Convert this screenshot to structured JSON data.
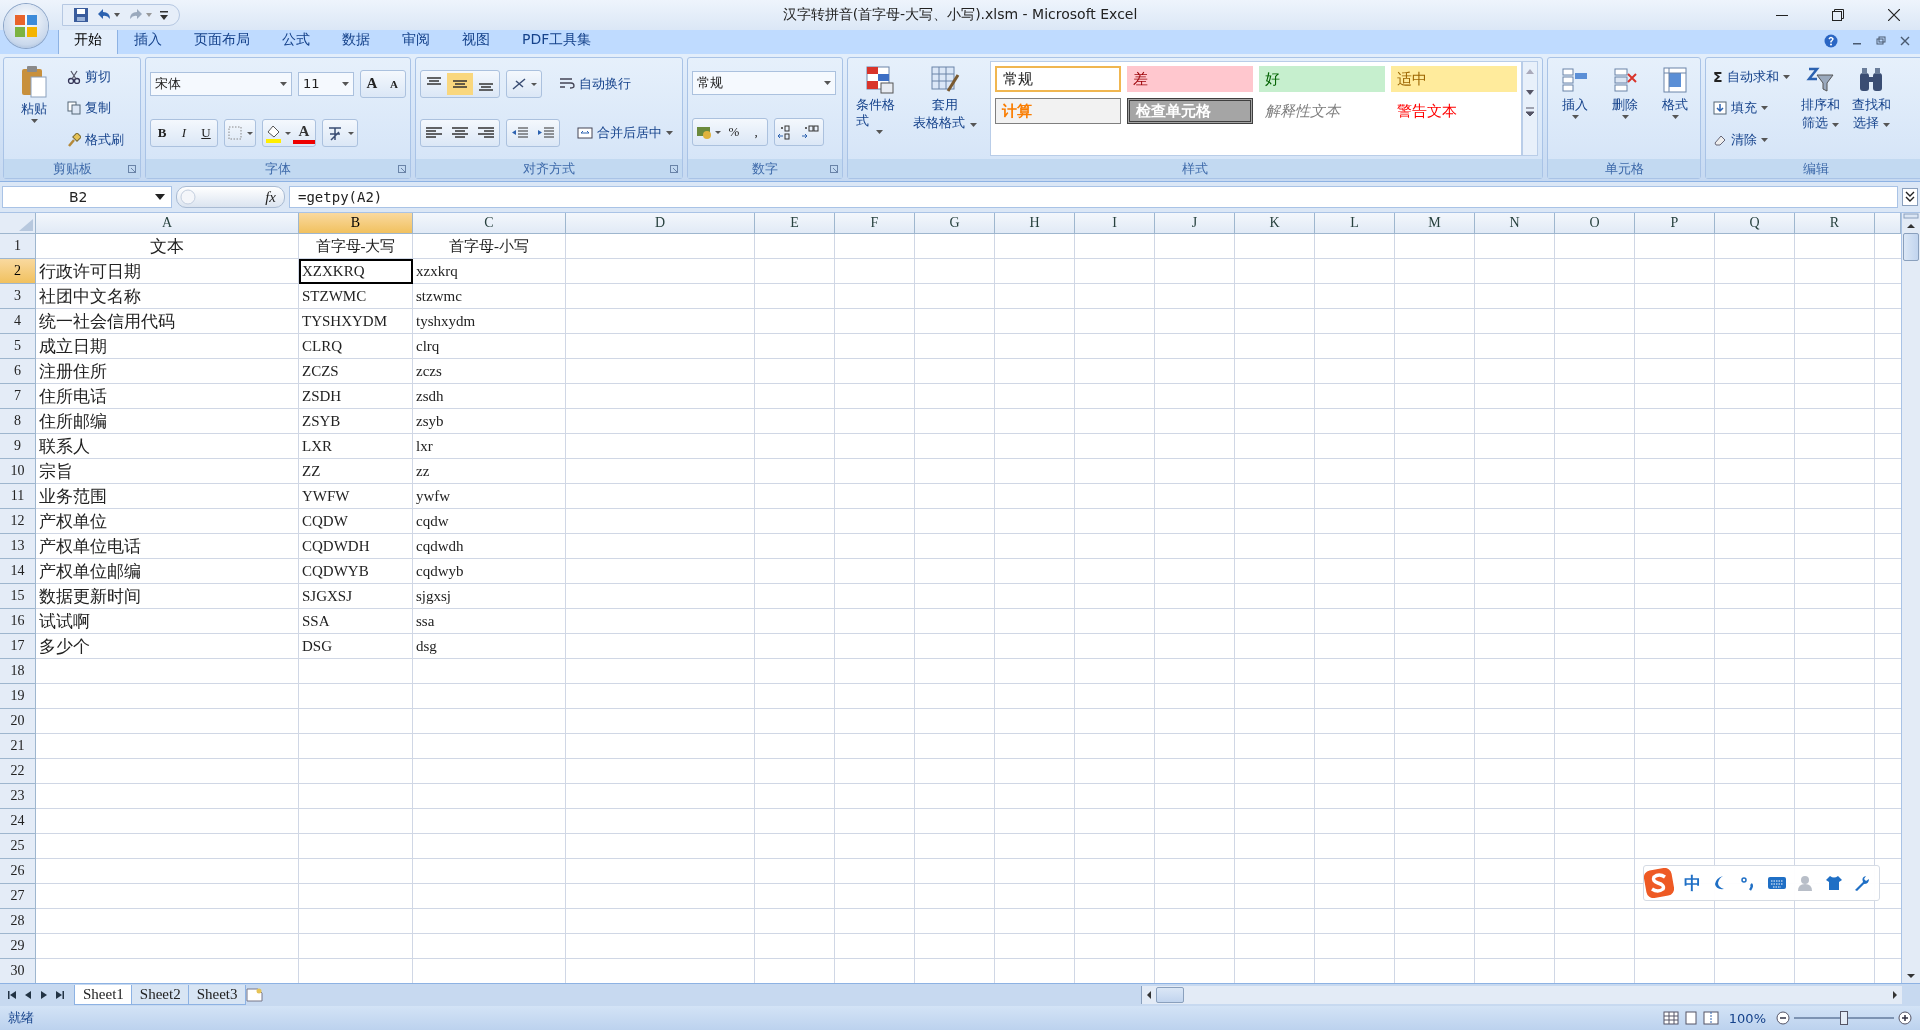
{
  "window": {
    "title": "汉字转拼音(首字母-大写、小写).xlsm - Microsoft Excel"
  },
  "menu_tabs": [
    {
      "label": "开始",
      "selected": true
    },
    {
      "label": "插入",
      "selected": false
    },
    {
      "label": "页面布局",
      "selected": false
    },
    {
      "label": "公式",
      "selected": false
    },
    {
      "label": "数据",
      "selected": false
    },
    {
      "label": "审阅",
      "selected": false
    },
    {
      "label": "视图",
      "selected": false
    },
    {
      "label": "PDF工具集",
      "selected": false
    }
  ],
  "ribbon": {
    "clipboard": {
      "label": "剪贴板",
      "paste": "粘贴",
      "commands": [
        "剪切",
        "复制",
        "格式刷"
      ]
    },
    "font": {
      "label": "字体",
      "font_name": "宋体",
      "font_size": "11",
      "grow": "A",
      "shrink": "A",
      "format_buttons": [
        "B",
        "I",
        "U"
      ],
      "color_letter": "A"
    },
    "alignment": {
      "label": "对齐方式",
      "wrap": "自动换行",
      "merge": "合并后居中"
    },
    "number": {
      "label": "数字",
      "format": "常规",
      "percent": "%",
      "comma": ","
    },
    "styles": {
      "label": "样式",
      "conditional": "条件格式",
      "table_format": [
        "套用",
        "表格格式"
      ],
      "cell_styles": [
        {
          "name": "常规",
          "kind": "normal"
        },
        {
          "name": "差",
          "kind": "bad"
        },
        {
          "name": "好",
          "kind": "good"
        },
        {
          "name": "适中",
          "kind": "neutral"
        },
        {
          "name": "计算",
          "kind": "calculation"
        },
        {
          "name": "检查单元格",
          "kind": "check"
        },
        {
          "name": "解释性文本",
          "kind": "explanatory"
        },
        {
          "name": "警告文本",
          "kind": "warning"
        }
      ]
    },
    "cells": {
      "label": "单元格",
      "commands": [
        "插入",
        "删除",
        "格式"
      ]
    },
    "editing": {
      "label": "编辑",
      "autosum_symbol": "Σ",
      "commands": [
        "自动求和",
        "填充",
        "清除"
      ],
      "large": [
        [
          "排序和",
          "筛选"
        ],
        [
          "查找和",
          "选择"
        ]
      ]
    }
  },
  "formula_bar": {
    "name_box": "B2",
    "fx": "fx",
    "formula": "=getpy(A2)"
  },
  "sheet": {
    "columns": [
      {
        "label": "A",
        "selected": false
      },
      {
        "label": "B",
        "selected": true
      },
      {
        "label": "C",
        "selected": false
      },
      {
        "label": "D",
        "selected": false
      },
      {
        "label": "E",
        "selected": false
      },
      {
        "label": "F",
        "selected": false
      },
      {
        "label": "G",
        "selected": false
      },
      {
        "label": "H",
        "selected": false
      },
      {
        "label": "I",
        "selected": false
      },
      {
        "label": "J",
        "selected": false
      },
      {
        "label": "K",
        "selected": false
      },
      {
        "label": "L",
        "selected": false
      },
      {
        "label": "M",
        "selected": false
      },
      {
        "label": "N",
        "selected": false
      },
      {
        "label": "O",
        "selected": false
      },
      {
        "label": "P",
        "selected": false
      },
      {
        "label": "Q",
        "selected": false
      },
      {
        "label": "R",
        "selected": false
      }
    ],
    "rows": [
      {
        "number": "1",
        "kind": "header",
        "selected": false,
        "cells": [
          "文本",
          "首字母-大写",
          "首字母-小写"
        ]
      },
      {
        "number": "2",
        "kind": "data",
        "selected": true,
        "cells": [
          "行政许可日期",
          "XZXKRQ",
          "xzxkrq"
        ]
      },
      {
        "number": "3",
        "kind": "data",
        "selected": false,
        "cells": [
          "社团中文名称",
          "STZWMC",
          "stzwmc"
        ]
      },
      {
        "number": "4",
        "kind": "data",
        "selected": false,
        "cells": [
          "统一社会信用代码",
          "TYSHXYDM",
          "tyshxydm"
        ]
      },
      {
        "number": "5",
        "kind": "data",
        "selected": false,
        "cells": [
          "成立日期",
          "CLRQ",
          "clrq"
        ]
      },
      {
        "number": "6",
        "kind": "data",
        "selected": false,
        "cells": [
          "注册住所",
          "ZCZS",
          "zczs"
        ]
      },
      {
        "number": "7",
        "kind": "data",
        "selected": false,
        "cells": [
          "住所电话",
          "ZSDH",
          "zsdh"
        ]
      },
      {
        "number": "8",
        "kind": "data",
        "selected": false,
        "cells": [
          "住所邮编",
          "ZSYB",
          "zsyb"
        ]
      },
      {
        "number": "9",
        "kind": "data",
        "selected": false,
        "cells": [
          "联系人",
          "LXR",
          "lxr"
        ]
      },
      {
        "number": "10",
        "kind": "data",
        "selected": false,
        "cells": [
          "宗旨",
          "ZZ",
          "zz"
        ]
      },
      {
        "number": "11",
        "kind": "data",
        "selected": false,
        "cells": [
          "业务范围",
          "YWFW",
          "ywfw"
        ]
      },
      {
        "number": "12",
        "kind": "data",
        "selected": false,
        "cells": [
          "产权单位",
          "CQDW",
          "cqdw"
        ]
      },
      {
        "number": "13",
        "kind": "data",
        "selected": false,
        "cells": [
          "产权单位电话",
          "CQDWDH",
          "cqdwdh"
        ]
      },
      {
        "number": "14",
        "kind": "data",
        "selected": false,
        "cells": [
          "产权单位邮编",
          "CQDWYB",
          "cqdwyb"
        ]
      },
      {
        "number": "15",
        "kind": "data",
        "selected": false,
        "cells": [
          "数据更新时间",
          "SJGXSJ",
          "sjgxsj"
        ]
      },
      {
        "number": "16",
        "kind": "data",
        "selected": false,
        "cells": [
          "试试啊",
          "SSA",
          "ssa"
        ]
      },
      {
        "number": "17",
        "kind": "data",
        "selected": false,
        "cells": [
          "多少个",
          "DSG",
          "dsg"
        ]
      },
      {
        "number": "18",
        "kind": "data",
        "selected": false
      },
      {
        "number": "19",
        "kind": "data",
        "selected": false
      },
      {
        "number": "20",
        "kind": "data",
        "selected": false
      },
      {
        "number": "21",
        "kind": "data",
        "selected": false
      },
      {
        "number": "22",
        "kind": "data",
        "selected": false
      },
      {
        "number": "23",
        "kind": "data",
        "selected": false
      },
      {
        "number": "24",
        "kind": "data",
        "selected": false
      },
      {
        "number": "25",
        "kind": "data",
        "selected": false
      },
      {
        "number": "26",
        "kind": "data",
        "selected": false
      },
      {
        "number": "27",
        "kind": "data",
        "selected": false
      },
      {
        "number": "28",
        "kind": "data",
        "selected": false
      },
      {
        "number": "29",
        "kind": "data",
        "selected": false
      },
      {
        "number": "30",
        "kind": "data",
        "selected": false
      }
    ]
  },
  "sheet_tabs": [
    {
      "label": "Sheet1",
      "selected": true
    },
    {
      "label": "Sheet2",
      "selected": false
    },
    {
      "label": "Sheet3",
      "selected": false
    }
  ],
  "status_bar": {
    "text": "就绪",
    "zoom": "100%",
    "zoom_slider": {
      "level": 0.5
    }
  },
  "ime_toolbar": {
    "mode": "中"
  }
}
